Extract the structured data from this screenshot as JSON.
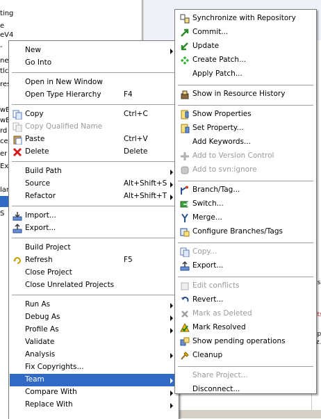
{
  "background": {
    "left_fragments": [
      "ting",
      "e",
      "eV4",
      "-",
      "ner",
      "tlc",
      "res",
      "wE",
      "wE",
      "rd",
      "ce",
      "er",
      "Ex",
      "lan",
      "S"
    ],
    "right_fragments": [
      "nse",
      "ets",
      "app",
      "rz."
    ]
  },
  "context_menu": {
    "items": [
      {
        "label": "New",
        "submenu": true
      },
      {
        "label": "Go Into"
      },
      {
        "separator": true
      },
      {
        "label": "Open in New Window"
      },
      {
        "label": "Open Type Hierarchy",
        "shortcut": "F4"
      },
      {
        "separator": true
      },
      {
        "label": "Copy",
        "shortcut": "Ctrl+C",
        "icon": "copy-icon"
      },
      {
        "label": "Copy Qualified Name",
        "disabled": true,
        "icon": "copy-qualified-icon"
      },
      {
        "label": "Paste",
        "shortcut": "Ctrl+V",
        "icon": "paste-icon"
      },
      {
        "label": "Delete",
        "shortcut": "Delete",
        "icon": "delete-icon"
      },
      {
        "separator": true
      },
      {
        "label": "Build Path",
        "submenu": true
      },
      {
        "label": "Source",
        "shortcut": "Alt+Shift+S",
        "submenu": true
      },
      {
        "label": "Refactor",
        "shortcut": "Alt+Shift+T",
        "submenu": true
      },
      {
        "separator": true
      },
      {
        "label": "Import...",
        "icon": "import-icon"
      },
      {
        "label": "Export...",
        "icon": "export-icon"
      },
      {
        "separator": true
      },
      {
        "label": "Build Project"
      },
      {
        "label": "Refresh",
        "shortcut": "F5",
        "icon": "refresh-icon"
      },
      {
        "label": "Close Project"
      },
      {
        "label": "Close Unrelated Projects"
      },
      {
        "separator": true
      },
      {
        "label": "Run As",
        "submenu": true
      },
      {
        "label": "Debug As",
        "submenu": true
      },
      {
        "label": "Profile As",
        "submenu": true
      },
      {
        "label": "Validate"
      },
      {
        "label": "Analysis",
        "submenu": true
      },
      {
        "label": "Fix Copyrights..."
      },
      {
        "label": "Team",
        "submenu": true,
        "selected": true
      },
      {
        "label": "Compare With",
        "submenu": true
      },
      {
        "label": "Replace With",
        "submenu": true
      }
    ]
  },
  "team_submenu": {
    "items": [
      {
        "label": "Synchronize with Repository",
        "icon": "synchronize-icon"
      },
      {
        "label": "Commit...",
        "icon": "commit-icon"
      },
      {
        "label": "Update",
        "icon": "update-icon"
      },
      {
        "label": "Create Patch...",
        "icon": "create-patch-icon"
      },
      {
        "label": "Apply Patch..."
      },
      {
        "separator": true
      },
      {
        "label": "Show in Resource History",
        "icon": "resource-history-icon"
      },
      {
        "separator": true
      },
      {
        "label": "Show Properties",
        "icon": "show-properties-icon"
      },
      {
        "label": "Set Property...",
        "icon": "set-property-icon"
      },
      {
        "label": "Add Keywords..."
      },
      {
        "label": "Add to Version Control",
        "disabled": true,
        "icon": "add-version-control-icon"
      },
      {
        "label": "Add to svn:ignore",
        "disabled": true,
        "icon": "svn-ignore-icon"
      },
      {
        "separator": true
      },
      {
        "label": "Branch/Tag...",
        "icon": "branch-tag-icon"
      },
      {
        "label": "Switch...",
        "icon": "switch-icon"
      },
      {
        "label": "Merge...",
        "icon": "merge-icon"
      },
      {
        "label": "Configure Branches/Tags",
        "icon": "configure-branches-icon"
      },
      {
        "separator": true
      },
      {
        "label": "Copy...",
        "disabled": true,
        "icon": "copy-icon"
      },
      {
        "label": "Export...",
        "icon": "export-icon"
      },
      {
        "separator": true
      },
      {
        "label": "Edit conflicts",
        "disabled": true,
        "icon": "edit-conflicts-icon"
      },
      {
        "label": "Revert...",
        "icon": "revert-icon"
      },
      {
        "label": "Mark as Deleted",
        "disabled": true,
        "icon": "mark-deleted-icon"
      },
      {
        "label": "Mark Resolved",
        "icon": "mark-resolved-icon"
      },
      {
        "label": "Show pending operations",
        "icon": "pending-operations-icon"
      },
      {
        "label": "Cleanup",
        "icon": "cleanup-icon"
      },
      {
        "separator": true
      },
      {
        "label": "Share Project...",
        "disabled": true
      },
      {
        "label": "Disconnect..."
      }
    ]
  }
}
